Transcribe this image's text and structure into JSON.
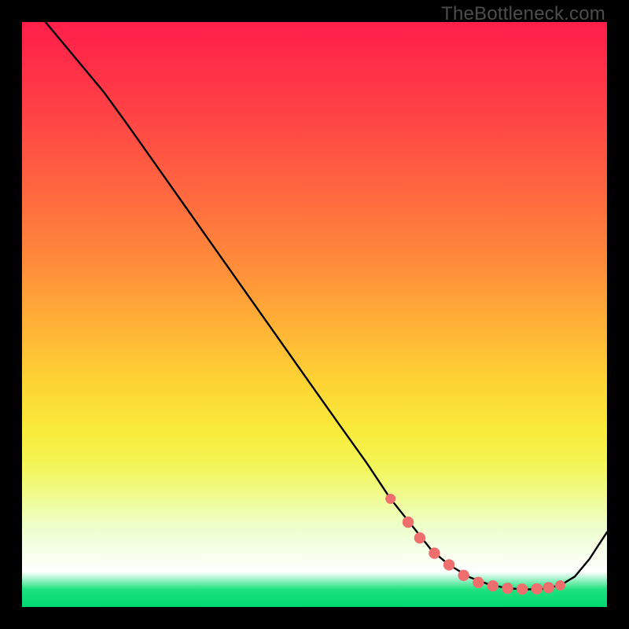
{
  "watermark": "TheBottleneck.com",
  "chart_data": {
    "type": "line",
    "title": "",
    "xlabel": "",
    "ylabel": "",
    "xlim": [
      0,
      100
    ],
    "ylim": [
      0,
      100
    ],
    "series": [
      {
        "name": "curve",
        "x": [
          4,
          9,
          14,
          18,
          24,
          30,
          36,
          42,
          48,
          54,
          59,
          63,
          67,
          70,
          73,
          76.5,
          80,
          83,
          86,
          89,
          92,
          94.5,
          97,
          100
        ],
        "values": [
          100,
          94,
          88,
          82.5,
          74,
          65.5,
          57,
          48.5,
          40,
          31.5,
          24.5,
          18.5,
          13.5,
          9.7,
          7.2,
          5.1,
          3.8,
          3.2,
          3.0,
          3.1,
          3.7,
          5.2,
          8.2,
          12.8
        ]
      }
    ],
    "markers": {
      "name": "highlight-dots",
      "color": "#ef6f6f",
      "x": [
        63,
        66,
        68,
        70.5,
        73,
        75.5,
        78,
        80.5,
        83,
        85.5,
        88,
        90,
        92
      ],
      "values": [
        18.5,
        14.5,
        11.8,
        9.2,
        7.2,
        5.4,
        4.2,
        3.6,
        3.2,
        3.05,
        3.1,
        3.3,
        3.7
      ]
    },
    "gradient_stops": [
      {
        "pos": 0,
        "color": "#ff1f4a"
      },
      {
        "pos": 50,
        "color": "#ffb236"
      },
      {
        "pos": 75,
        "color": "#f4f551"
      },
      {
        "pos": 95,
        "color": "#ffffff"
      },
      {
        "pos": 100,
        "color": "#00d86e"
      }
    ]
  }
}
